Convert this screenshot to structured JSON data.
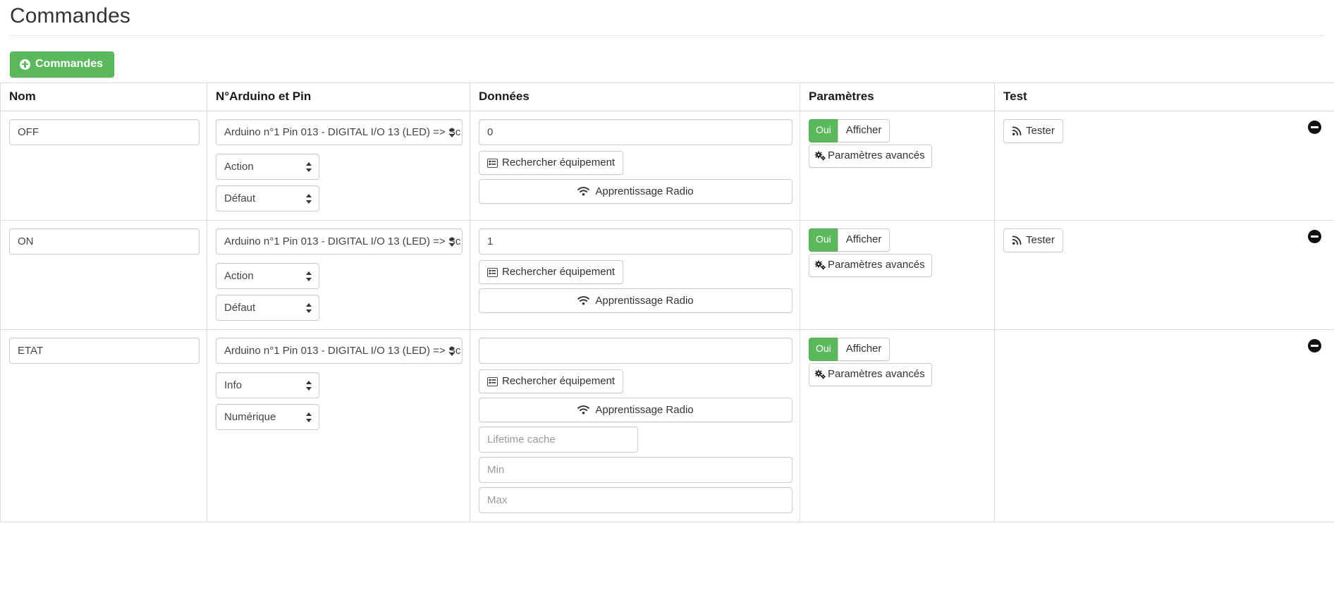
{
  "page": {
    "title": "Commandes"
  },
  "toolbar": {
    "add_label": "Commandes",
    "add_icon": "plus-circle-icon",
    "accent_green": "#5cb85c"
  },
  "table": {
    "headers": {
      "nom": "Nom",
      "pin": "N°Arduino et Pin",
      "donnees": "Données",
      "parametres": "Paramètres",
      "test": "Test"
    },
    "shared_labels": {
      "rechercher": "Rechercher équipement",
      "rechercher_icon": "list-alt-icon",
      "apprentissage": "Apprentissage Radio",
      "apprentissage_icon": "wifi-icon",
      "toggle_on": "Oui",
      "toggle_off": "Afficher",
      "advanced": "Paramètres avancés",
      "advanced_icon": "cogs-icon",
      "tester": "Tester",
      "tester_icon": "rss-icon",
      "remove_icon": "minus-circle-icon"
    },
    "rows": [
      {
        "name": "OFF",
        "pin_select": "Arduino n°1 Pin 013 - DIGITAL I/O 13 (LED) => Sc",
        "type_select": "Action",
        "subtype_select": "Défaut",
        "data_value": "0",
        "data_placeholder": "",
        "has_test": true,
        "extra_fields": []
      },
      {
        "name": "ON",
        "pin_select": "Arduino n°1 Pin 013 - DIGITAL I/O 13 (LED) => Sc",
        "type_select": "Action",
        "subtype_select": "Défaut",
        "data_value": "1",
        "data_placeholder": "",
        "has_test": true,
        "extra_fields": []
      },
      {
        "name": "ETAT",
        "pin_select": "Arduino n°1 Pin 013 - DIGITAL I/O 13 (LED) => Sc",
        "type_select": "Info",
        "subtype_select": "Numérique",
        "data_value": "",
        "data_placeholder": "",
        "has_test": false,
        "extra_fields": [
          {
            "placeholder": "Lifetime cache",
            "width": "small"
          },
          {
            "placeholder": "Min",
            "width": "full"
          },
          {
            "placeholder": "Max",
            "width": "full"
          }
        ]
      }
    ]
  }
}
